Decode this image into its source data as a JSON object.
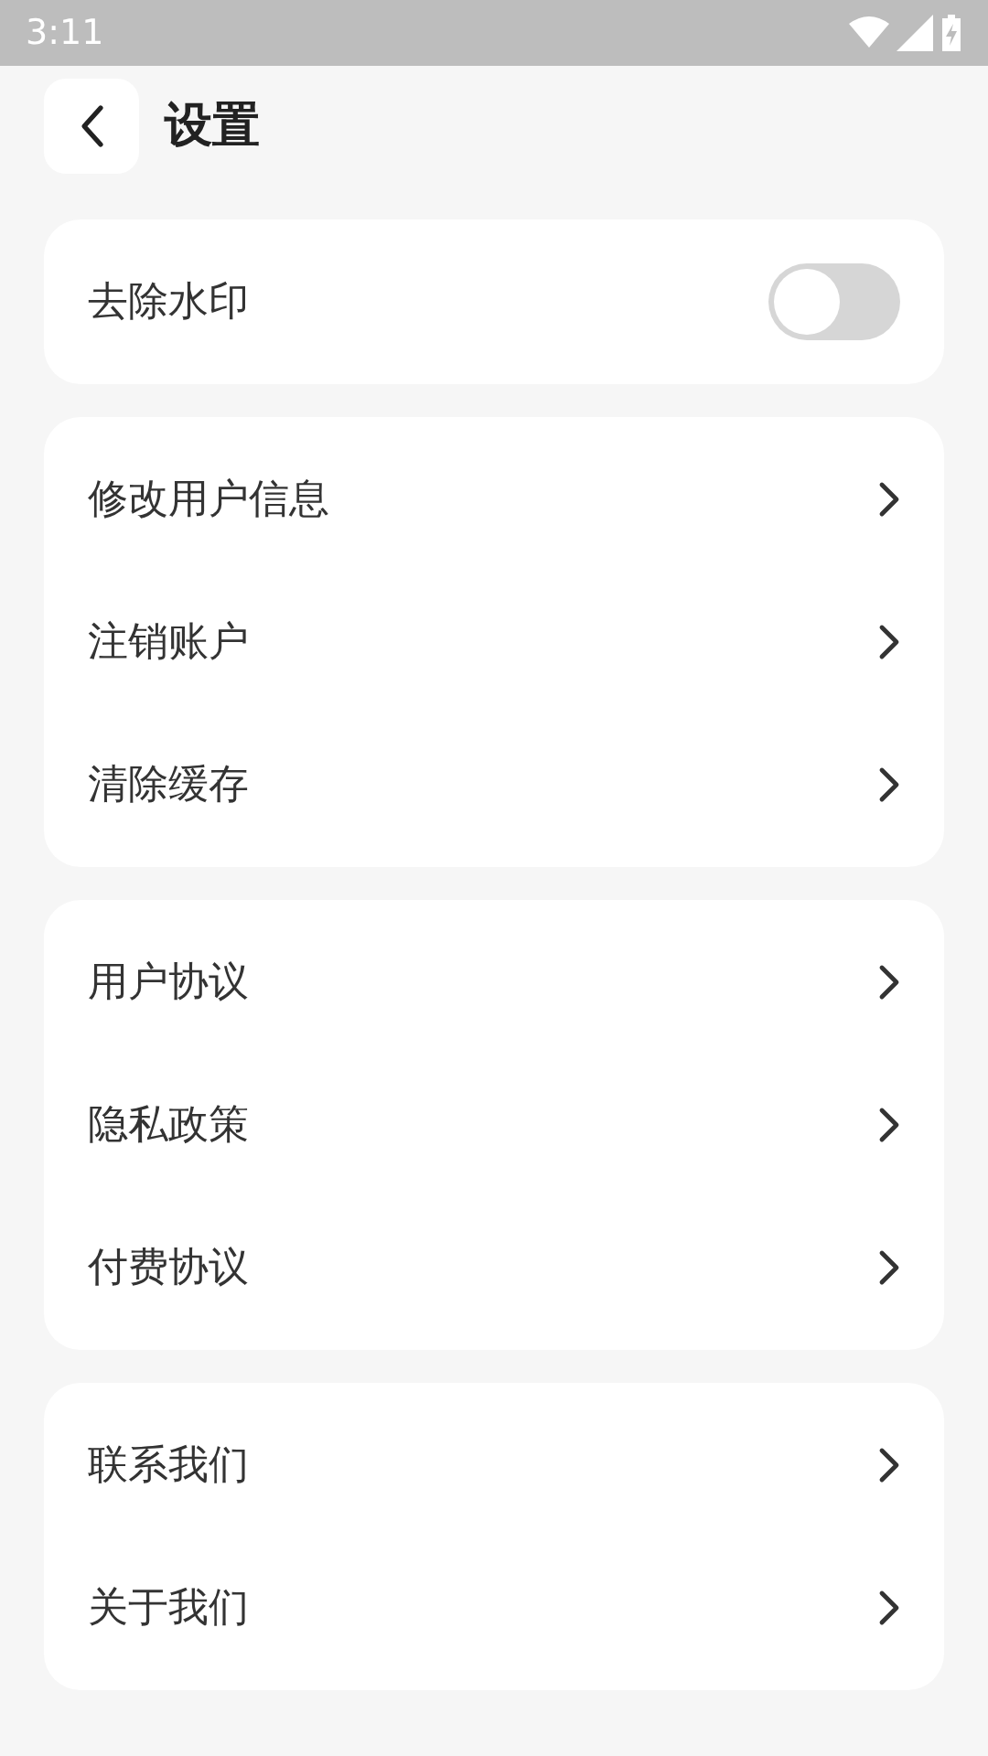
{
  "status_bar": {
    "time": "3:11"
  },
  "header": {
    "title": "设置"
  },
  "groups": [
    {
      "items": [
        {
          "kind": "toggle",
          "label": "去除水印",
          "on": false
        }
      ]
    },
    {
      "items": [
        {
          "kind": "link",
          "label": "修改用户信息"
        },
        {
          "kind": "link",
          "label": "注销账户"
        },
        {
          "kind": "link",
          "label": "清除缓存"
        }
      ]
    },
    {
      "items": [
        {
          "kind": "link",
          "label": "用户协议"
        },
        {
          "kind": "link",
          "label": "隐私政策"
        },
        {
          "kind": "link",
          "label": "付费协议"
        }
      ]
    },
    {
      "items": [
        {
          "kind": "link",
          "label": "联系我们"
        },
        {
          "kind": "link",
          "label": "关于我们"
        }
      ]
    }
  ]
}
